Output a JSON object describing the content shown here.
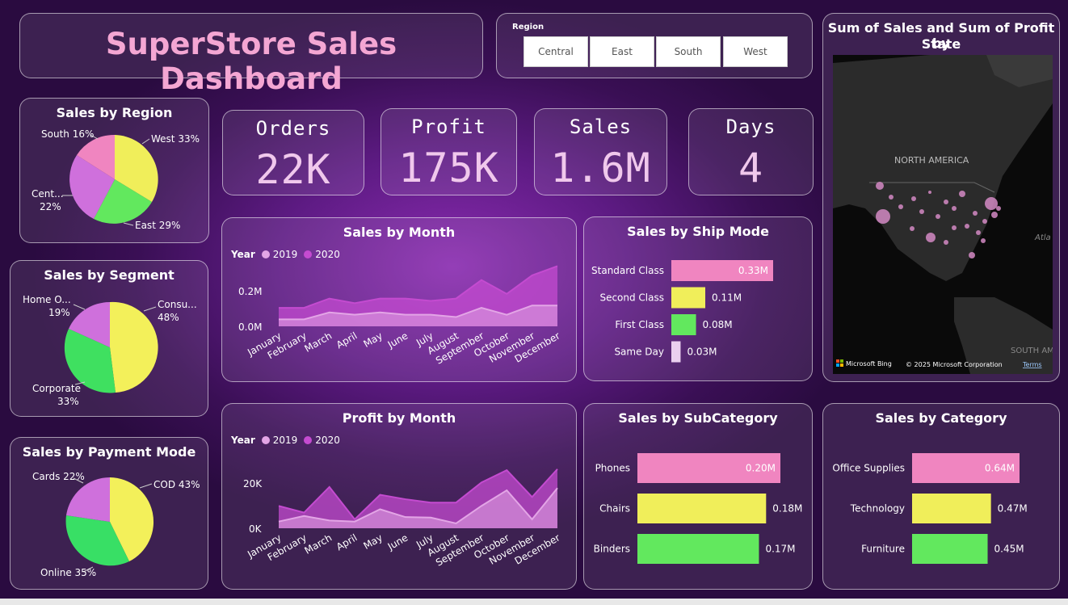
{
  "header": {
    "title": "SuperStore Sales Dashboard"
  },
  "slicer": {
    "label": "Region",
    "options": [
      "Central",
      "East",
      "South",
      "West"
    ]
  },
  "kpis": [
    {
      "label": "Orders",
      "value": "22K"
    },
    {
      "label": "Profit",
      "value": "175K"
    },
    {
      "label": "Sales",
      "value": "1.6M"
    },
    {
      "label": "Days",
      "value": "4"
    }
  ],
  "colors": {
    "pink": "#f085c0",
    "yellow": "#f0ee5a",
    "green": "#62e85e",
    "orchid": "#cf70dc",
    "light": "#ead0ef",
    "s2019": "#e3a5e6",
    "s2020": "#c44bd0"
  },
  "region_pie": {
    "title": "Sales by Region",
    "labels": [
      "West 33%",
      "East 29%",
      "Cent...",
      "22%",
      "South 16%"
    ]
  },
  "segment_pie": {
    "title": "Sales by Segment",
    "labels": [
      "Consu...",
      "48%",
      "Corporate",
      "33%",
      "Home O...",
      "19%"
    ]
  },
  "payment_pie": {
    "title": "Sales by Payment Mode",
    "labels": [
      "COD 43%",
      "Online 35%",
      "Cards 22%"
    ]
  },
  "sales_month": {
    "title": "Sales by Month",
    "legend_label": "Year",
    "ytick_labels": [
      "0.2M",
      "0.0M"
    ]
  },
  "profit_month": {
    "title": "Profit by Month",
    "legend_label": "Year",
    "ytick_labels": [
      "20K",
      "0K"
    ]
  },
  "ship_mode": {
    "title": "Sales by Ship Mode"
  },
  "subcategory": {
    "title": "Sales by SubCategory"
  },
  "category": {
    "title": "Sales by Category"
  },
  "map": {
    "title_line1": "Sum of Sales and Sum of Profit by",
    "title_line2": "State",
    "labels": {
      "na": "NORTH AMERICA",
      "atl": "Atla",
      "sa": "SOUTH AM",
      "bing": "Microsoft Bing",
      "copyright": "© 2025 Microsoft Corporation",
      "terms": "Terms"
    }
  },
  "chart_data": [
    {
      "type": "pie",
      "title": "Sales by Region",
      "categories": [
        "West",
        "East",
        "Central",
        "South"
      ],
      "values": [
        33,
        29,
        22,
        16
      ]
    },
    {
      "type": "pie",
      "title": "Sales by Segment",
      "categories": [
        "Consumer",
        "Corporate",
        "Home Office"
      ],
      "values": [
        48,
        33,
        19
      ]
    },
    {
      "type": "pie",
      "title": "Sales by Payment Mode",
      "categories": [
        "COD",
        "Online",
        "Cards"
      ],
      "values": [
        43,
        35,
        22
      ]
    },
    {
      "type": "area",
      "title": "Sales by Month",
      "categories": [
        "January",
        "February",
        "March",
        "April",
        "May",
        "June",
        "July",
        "August",
        "September",
        "October",
        "November",
        "December"
      ],
      "series": [
        {
          "name": "2019",
          "values": [
            0.03,
            0.03,
            0.06,
            0.05,
            0.06,
            0.05,
            0.05,
            0.04,
            0.08,
            0.05,
            0.09,
            0.09
          ]
        },
        {
          "name": "2020",
          "values": [
            0.08,
            0.08,
            0.12,
            0.1,
            0.12,
            0.12,
            0.11,
            0.12,
            0.2,
            0.14,
            0.22,
            0.26
          ]
        }
      ],
      "ylim": [
        0,
        0.3
      ]
    },
    {
      "type": "area",
      "title": "Profit by Month",
      "categories": [
        "January",
        "February",
        "March",
        "April",
        "May",
        "June",
        "July",
        "August",
        "September",
        "October",
        "November",
        "December"
      ],
      "series": [
        {
          "name": "2019",
          "values": [
            3000,
            5500,
            3500,
            3000,
            8500,
            5000,
            4800,
            2200,
            10000,
            17000,
            4000,
            18000
          ]
        },
        {
          "name": "2020",
          "values": [
            10000,
            7000,
            18500,
            4000,
            15000,
            13000,
            11500,
            11500,
            20500,
            26000,
            14000,
            26500
          ]
        }
      ],
      "ylim": [
        0,
        34000
      ]
    },
    {
      "type": "bar",
      "title": "Sales by Ship Mode",
      "categories": [
        "Standard Class",
        "Second Class",
        "First Class",
        "Same Day"
      ],
      "values": [
        0.33,
        0.11,
        0.08,
        0.03
      ],
      "value_labels": [
        "0.33M",
        "0.11M",
        "0.08M",
        "0.03M"
      ]
    },
    {
      "type": "bar",
      "title": "Sales by SubCategory",
      "categories": [
        "Phones",
        "Chairs",
        "Binders"
      ],
      "values": [
        0.2,
        0.18,
        0.17
      ],
      "value_labels": [
        "0.20M",
        "0.18M",
        "0.17M"
      ]
    },
    {
      "type": "bar",
      "title": "Sales by Category",
      "categories": [
        "Office Supplies",
        "Technology",
        "Furniture"
      ],
      "values": [
        0.64,
        0.47,
        0.45
      ],
      "value_labels": [
        "0.64M",
        "0.47M",
        "0.45M"
      ]
    }
  ]
}
